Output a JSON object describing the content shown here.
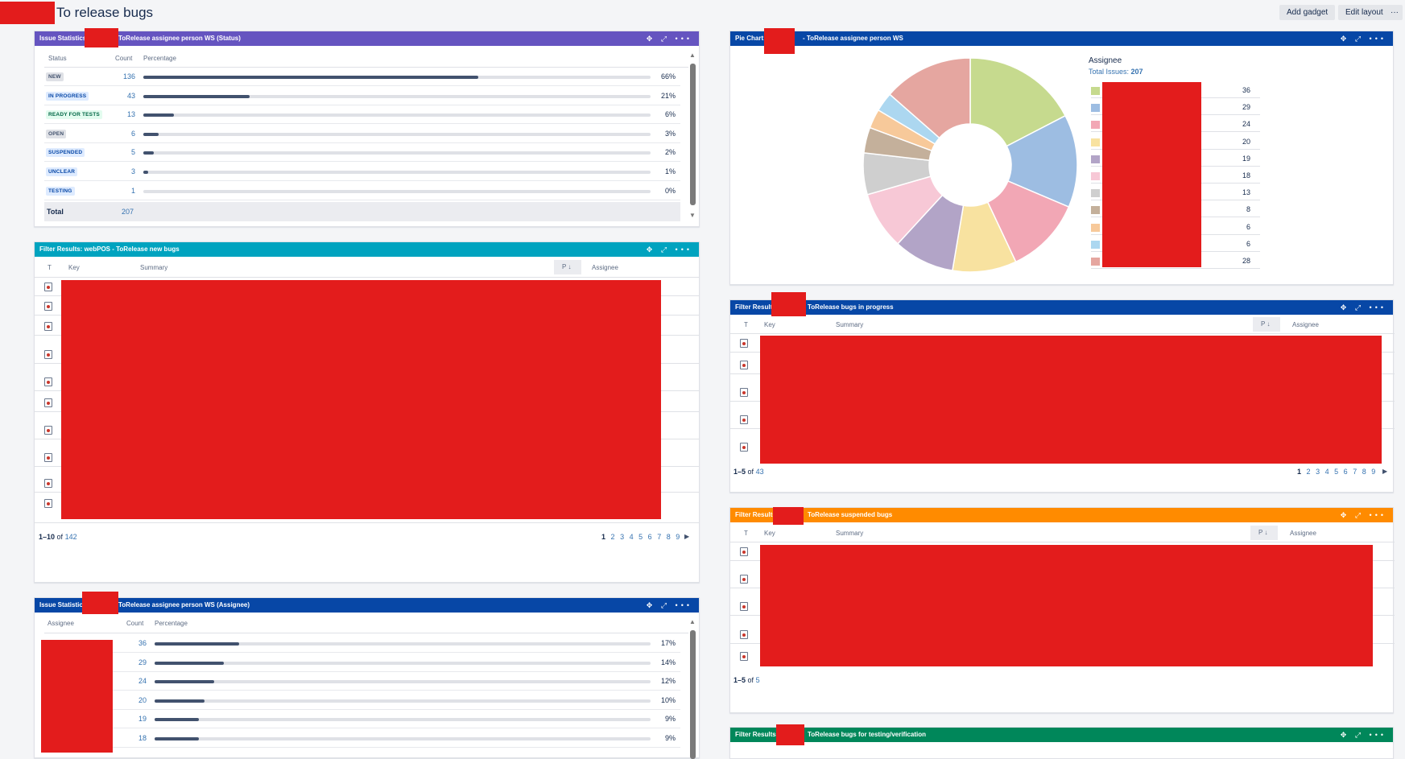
{
  "header": {
    "title": "To release bugs",
    "add_gadget": "Add gadget",
    "edit_layout": "Edit layout",
    "more": "···"
  },
  "gadget_status": {
    "title_prefix": "Issue Statistics:",
    "title_suffix": "ToRelease assignee person WS (Status)",
    "col_status": "Status",
    "col_count": "Count",
    "col_percentage": "Percentage",
    "rows": [
      {
        "label": "NEW",
        "count": "136",
        "pct": "66%",
        "frac": 0.66,
        "bg": "#dfe1e6",
        "fg": "#42526e"
      },
      {
        "label": "IN PROGRESS",
        "count": "43",
        "pct": "21%",
        "frac": 0.21,
        "bg": "#deebff",
        "fg": "#0747a6"
      },
      {
        "label": "READY FOR TESTS",
        "count": "13",
        "pct": "6%",
        "frac": 0.06,
        "bg": "#e3fcef",
        "fg": "#006644"
      },
      {
        "label": "OPEN",
        "count": "6",
        "pct": "3%",
        "frac": 0.03,
        "bg": "#dfe1e6",
        "fg": "#42526e"
      },
      {
        "label": "SUSPENDED",
        "count": "5",
        "pct": "2%",
        "frac": 0.02,
        "bg": "#deebff",
        "fg": "#0747a6"
      },
      {
        "label": "UNCLEAR",
        "count": "3",
        "pct": "1%",
        "frac": 0.01,
        "bg": "#deebff",
        "fg": "#0747a6"
      },
      {
        "label": "TESTING",
        "count": "1",
        "pct": "0%",
        "frac": 0.0,
        "bg": "#deebff",
        "fg": "#0747a6"
      }
    ],
    "total_label": "Total",
    "total_count": "207"
  },
  "gadget_new": {
    "title": "Filter Results: webPOS - ToRelease new bugs",
    "col_t": "T",
    "col_key": "Key",
    "col_summary": "Summary",
    "col_p": "P",
    "col_assignee": "Assignee",
    "range": "1–10",
    "of": "of",
    "total": "142",
    "pages": [
      "1",
      "2",
      "3",
      "4",
      "5",
      "6",
      "7",
      "8",
      "9"
    ]
  },
  "gadget_assignee": {
    "title_prefix": "Issue Statistics:",
    "title_suffix": "ToRelease assignee person WS (Assignee)",
    "col_assignee": "Assignee",
    "col_count": "Count",
    "col_percentage": "Percentage",
    "rows": [
      {
        "count": "36",
        "pct": "17%",
        "frac": 0.17
      },
      {
        "count": "29",
        "pct": "14%",
        "frac": 0.14
      },
      {
        "count": "24",
        "pct": "12%",
        "frac": 0.12
      },
      {
        "count": "20",
        "pct": "10%",
        "frac": 0.1
      },
      {
        "count": "19",
        "pct": "9%",
        "frac": 0.09
      },
      {
        "count": "18",
        "pct": "9%",
        "frac": 0.09
      }
    ]
  },
  "gadget_pie": {
    "title_prefix": "Pie Chart:",
    "title_suffix": "- ToRelease assignee person WS",
    "legend_title": "Assignee",
    "total_label": "Total Issues:",
    "total_value": "207"
  },
  "chart_data": {
    "type": "pie",
    "title": "",
    "values": [
      36,
      29,
      24,
      20,
      19,
      18,
      13,
      8,
      6,
      6,
      28
    ],
    "colors": [
      "#c6da8e",
      "#9dbde2",
      "#f2a7b5",
      "#f8e2a0",
      "#b2a4c7",
      "#f7c8d6",
      "#cfcfcf",
      "#c4b09b",
      "#f7c99a",
      "#acd7f0",
      "#e5a6a0"
    ]
  },
  "gadget_progress": {
    "title_prefix": "Filter Results:",
    "title_suffix": "ToRelease bugs in progress",
    "col_t": "T",
    "col_key": "Key",
    "col_summary": "Summary",
    "col_p": "P",
    "col_assignee": "Assignee",
    "range": "1–5",
    "of": "of",
    "total": "43",
    "pages": [
      "1",
      "2",
      "3",
      "4",
      "5",
      "6",
      "7",
      "8",
      "9"
    ]
  },
  "gadget_suspended": {
    "title_prefix": "Filter Results:",
    "title_suffix": "ToRelease suspended bugs",
    "col_t": "T",
    "col_key": "Key",
    "col_summary": "Summary",
    "col_p": "P",
    "col_assignee": "Assignee",
    "range": "1–5",
    "of": "of",
    "total": "5"
  },
  "gadget_testing": {
    "title_prefix": "Filter Results:",
    "title_suffix": "ToRelease bugs for testing/verification"
  },
  "controls": {
    "move": "✥",
    "expand": "⤢",
    "menu": "•••"
  },
  "colors": {
    "purple": "#6554c0",
    "blue": "#0747a6",
    "teal": "#00a3bf",
    "orange": "#ff8b00",
    "green": "#00875a",
    "redaction": "#e31c1c"
  }
}
